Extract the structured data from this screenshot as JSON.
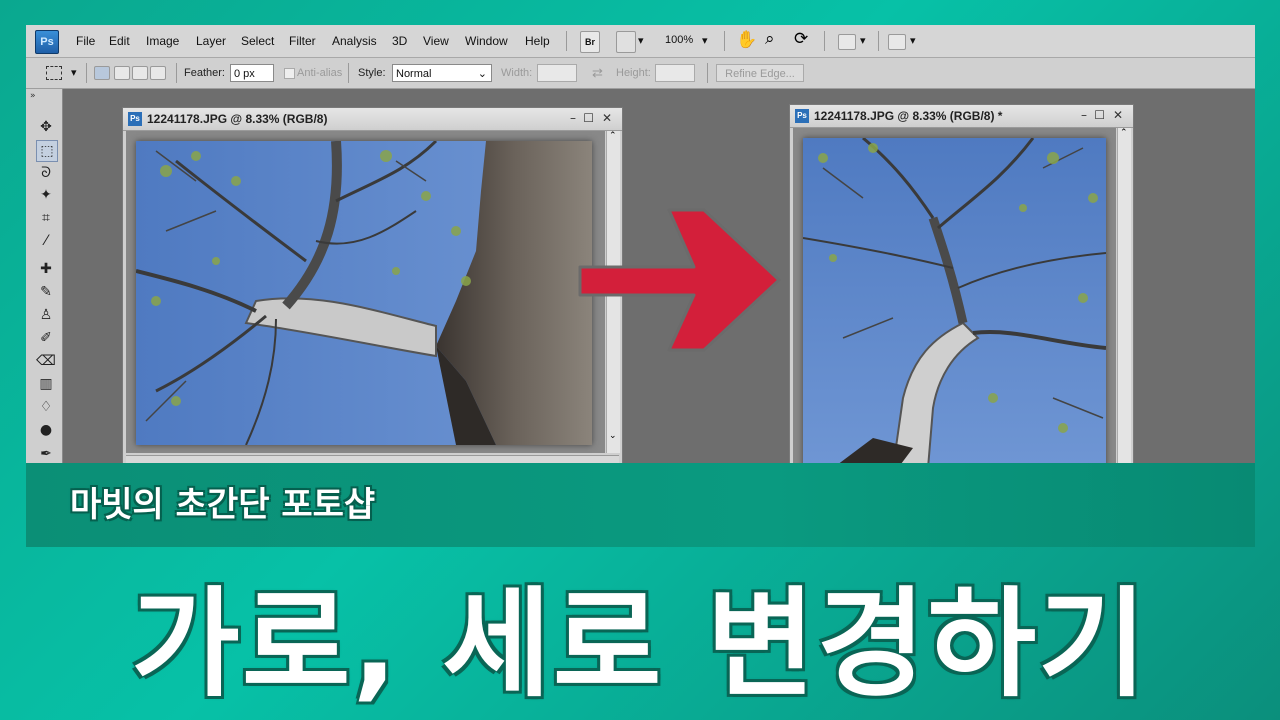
{
  "app": {
    "logo": "Ps"
  },
  "menu": {
    "items": [
      "File",
      "Edit",
      "Image",
      "Layer",
      "Select",
      "Filter",
      "Analysis",
      "3D",
      "View",
      "Window",
      "Help"
    ]
  },
  "toolbar": {
    "bridge": "Br",
    "zoom": "100%"
  },
  "options": {
    "feather_label": "Feather:",
    "feather_value": "0 px",
    "antialias_label": "Anti-alias",
    "style_label": "Style:",
    "style_value": "Normal",
    "width_label": "Width:",
    "height_label": "Height:",
    "refine_edge": "Refine Edge..."
  },
  "doc_left": {
    "title": "12241178.JPG @ 8.33% (RGB/8)"
  },
  "doc_right": {
    "title": "12241178.JPG @ 8.33% (RGB/8) *"
  },
  "banner": {
    "subtitle": "마빗의 초간단 포토샵",
    "title": "가로, 세로 변경하기"
  },
  "colors": {
    "arrow": "#d31f3a",
    "sky": "#5b84c8",
    "banner": "#0a9a80"
  }
}
